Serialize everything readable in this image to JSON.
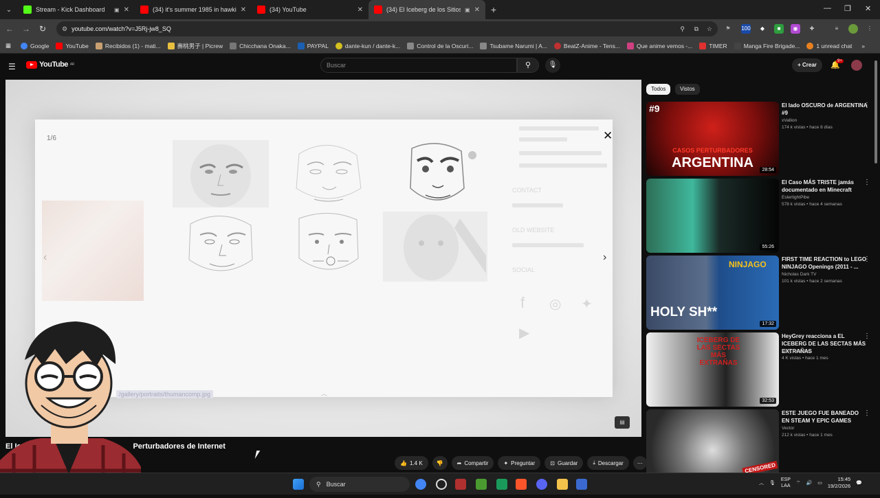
{
  "browser": {
    "tabs": [
      {
        "title": "Stream - Kick Dashboard",
        "color": "#53fc18"
      },
      {
        "title": "(34) it's summer 1985 in hawkin",
        "color": "#ff0000"
      },
      {
        "title": "(34) YouTube",
        "color": "#ff0000"
      },
      {
        "title": "(34) El Iceberg de los Sitios",
        "color": "#ff0000"
      }
    ],
    "url": "youtube.com/watch?v=J5Rj-jw8_SQ",
    "bookmarks": [
      "Google",
      "YouTube",
      "Recibidos (1) - mati...",
      "壽桃男子 | Picrew",
      "Chicchana Onaka...",
      "PAYPAL",
      "dante-kun / dante-k...",
      "Control de la Oscuri...",
      "Tsubame Narumi | A...",
      "BeatZ-Anime - Tens...",
      "Que anime vemos -...",
      "TIMER",
      "Manga Fire Brigade...",
      "1 unread chat"
    ]
  },
  "youtube": {
    "logo": "YouTube",
    "region": "AR",
    "search_placeholder": "Buscar",
    "create": "Crear",
    "notif_count": "9+"
  },
  "player": {
    "counter": "1/6",
    "ghost_texts": [
      "CONTACT",
      "OLD WEBSITE",
      "SOCIAL",
      "/gallery/portraits/thumancomp.jpg"
    ],
    "video_title_left": "El Iceb",
    "video_title_right": "Perturbadores de Internet"
  },
  "actions": {
    "likes": "1.4 K",
    "share": "Compartir",
    "ask": "Preguntar",
    "save": "Guardar",
    "download": "Descargar"
  },
  "sidebar": {
    "chips": [
      "Todos",
      "Vistos"
    ],
    "videos": [
      {
        "title": "El lado OSCURO de ARGENTINA #9",
        "channel": "xVallion",
        "meta": "174 k vistas • hace 8 días",
        "duration": "28:54",
        "thumb_top": "#9",
        "thumb_mid": "CASOS PERTURBADORES",
        "thumb_big": "ARGENTINA"
      },
      {
        "title": "El Caso MÁS TRISTE jamás documentado en Minecraft",
        "channel": "EsterlightPibe",
        "meta": "578 k vistas • hace 4 semanas",
        "duration": "55:26"
      },
      {
        "title": "FIRST TIME REACTION to LEGO NINJAGO Openings (2011 - ...",
        "channel": "Nicholas Dark TV",
        "meta": "101 k vistas • hace 2 semanas",
        "duration": "17:32",
        "thumb_big": "HOLY SH**",
        "thumb_tag": "NINJAGO"
      },
      {
        "title": "HeyGrey reacciona a EL ICEBERG DE LAS SECTAS MÁS EXTRAÑAS",
        "channel": "Grey Reaction",
        "meta": "4 K vistas • hace 1 mes",
        "duration": "32:53",
        "thumb_big": "ICEBERG DE LAS SECTAS MÁS EXTRAÑAS"
      },
      {
        "title": "ESTE JUEGO FUE BANEADO EN STEAM Y EPIC GAMES",
        "channel": "Vector",
        "meta": "212 k vistas • hace 1 mes",
        "thumb_tag": "CENSORED"
      }
    ]
  },
  "taskbar": {
    "search": "Buscar",
    "lang": "ESP",
    "lang2": "LAA",
    "time": "15:45",
    "date": "19/2/2026"
  },
  "colors": {
    "bg": "#0f0f0f",
    "accent": "#ff0000"
  }
}
